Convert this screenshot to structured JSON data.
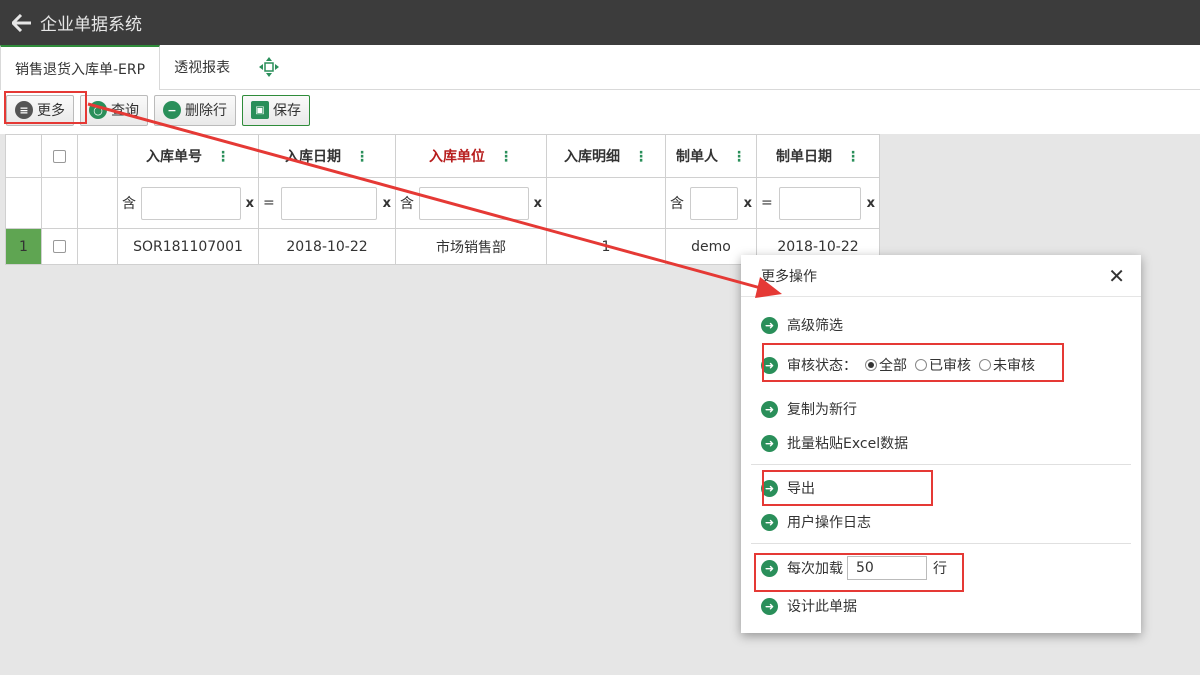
{
  "app": {
    "title": "企业单据系统"
  },
  "tabs": [
    {
      "label": "销售退货入库单-ERP"
    },
    {
      "label": "透视报表"
    }
  ],
  "toolbar": {
    "more": "更多",
    "query": "查询",
    "delete_row": "删除行",
    "save": "保存"
  },
  "grid": {
    "columns": [
      "入库单号",
      "入库日期",
      "入库单位",
      "入库明细",
      "制单人",
      "制单日期"
    ],
    "filters": {
      "col1_op": "含",
      "col2_op": "=",
      "col3_op": "含",
      "col5_op": "含",
      "col6_op": "=",
      "clear": "x"
    },
    "rows": [
      {
        "num": "1",
        "order_no": "SOR181107001",
        "date": "2018-10-22",
        "unit": "市场销售部",
        "detail": "1",
        "maker": "demo",
        "make_date": "2018-10-22"
      }
    ]
  },
  "dialog": {
    "title": "更多操作",
    "items": {
      "advanced_filter": "高级筛选",
      "audit_label": "审核状态：",
      "audit_all": "全部",
      "audit_done": "已审核",
      "audit_pending": "未审核",
      "copy_row": "复制为新行",
      "paste_excel": "批量粘贴Excel数据",
      "export": "导出",
      "user_log": "用户操作日志",
      "load_label": "每次加载",
      "load_value": "50",
      "load_unit": "行",
      "design": "设计此单据"
    }
  },
  "colors": {
    "accent": "#2a8f5a",
    "annotation": "#e53935",
    "topbar": "#3c3c3c"
  }
}
